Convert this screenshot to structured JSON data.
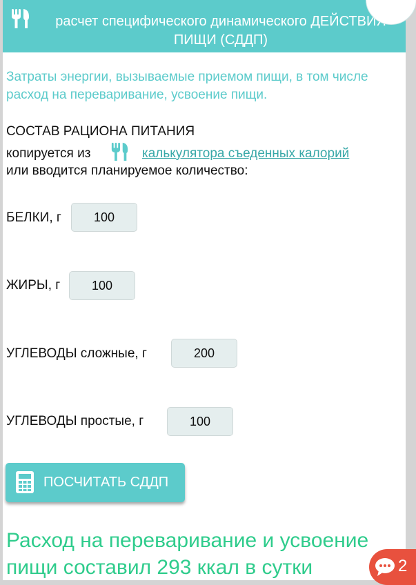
{
  "header": {
    "title_line1": "расчет специфического динамического ДЕЙСТВИЯ",
    "title_line2": "ПИЩИ (СДДП)",
    "icon": "fork-knife-icon"
  },
  "intro_text": "Затраты энергии, вызываемые приемом пищи, в том числе расход на переваривание, усвоение пищи.",
  "section": {
    "title": "СОСТАВ РАЦИОНА ПИТАНИЯ",
    "copy_prefix": "копируется из",
    "copy_link": "калькулятора съеденных калорий",
    "enter_text": "или вводится планируемое количество:"
  },
  "fields": [
    {
      "label": "БЕЛКИ, г",
      "value": "100"
    },
    {
      "label": "ЖИРЫ, г",
      "value": "100"
    },
    {
      "label": "УГЛЕВОДЫ сложные, г",
      "value": "200"
    },
    {
      "label": "УГЛЕВОДЫ простые, г",
      "value": "100"
    }
  ],
  "button": {
    "label": "ПОСЧИТАТЬ СДДП",
    "icon": "calculator-icon"
  },
  "result_text": "Расход на переваривание и усвоение пищи составил 293 ккал в сутки",
  "chat": {
    "count": "2",
    "icon": "chat-bubble-icon"
  },
  "colors": {
    "accent": "#5ccbcb",
    "result": "#2fcc8c",
    "chat": "#e8513e"
  }
}
